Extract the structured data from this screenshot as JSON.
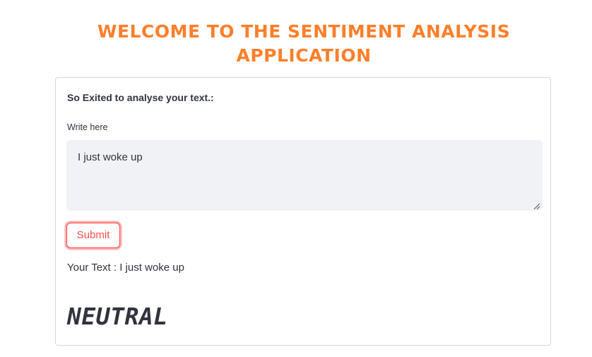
{
  "header": {
    "title_line1": "WELCOME TO THE SENTIMENT ANALYSIS",
    "title_line2": "APPLICATION",
    "title_color": "#ff7f2a"
  },
  "form": {
    "prompt": "So Exited to analyse your text.:",
    "field_label": "Write here",
    "field_value": "I just woke up",
    "submit_label": "Submit",
    "submit_color": "#ff4b4b"
  },
  "result": {
    "your_text": "Your Text : I just woke up",
    "sentiment": "NEUTRAL"
  }
}
